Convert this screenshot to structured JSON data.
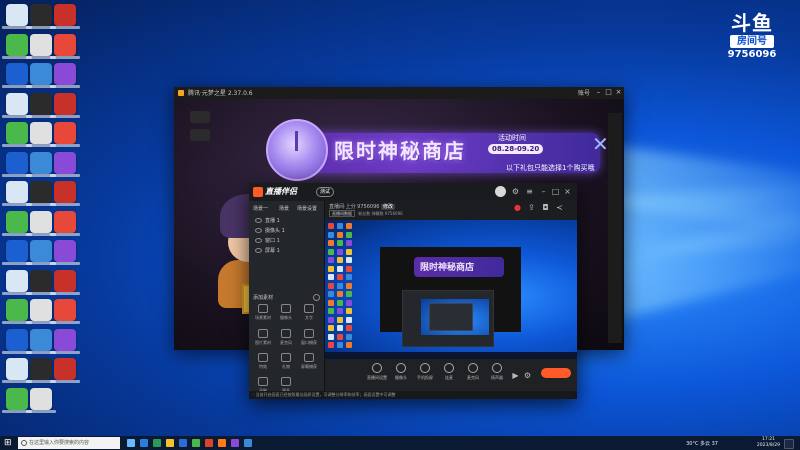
{
  "watermark": {
    "logo": "斗鱼",
    "room_label": "房间号",
    "room_id": "9756096"
  },
  "game_window": {
    "title": "腾讯·元梦之星 2.37.0.6",
    "account": "账号",
    "banner": {
      "title": "限时神秘商店",
      "time_label": "活动时间",
      "time_range": "08.28-09.20",
      "subtitle": "以下礼包只能选择1个购买哦"
    }
  },
  "live_window": {
    "app_name": "直播伴侣",
    "badge": "测试",
    "scene_tabs": [
      "场景一",
      "场景",
      "场景设置"
    ],
    "sources": [
      "直播 1",
      "摄像头 1",
      "窗口 1",
      "屏幕 1"
    ],
    "add_source": "添加素材",
    "tools": [
      {
        "icon": "video-icon",
        "label": "场景素材"
      },
      {
        "icon": "camera-icon",
        "label": "摄像头"
      },
      {
        "icon": "text-icon",
        "label": "文字"
      },
      {
        "icon": "image-icon",
        "label": "图片素材"
      },
      {
        "icon": "mic-icon",
        "label": "麦克风"
      },
      {
        "icon": "window-icon",
        "label": "窗口捕获"
      },
      {
        "icon": "effect-icon",
        "label": "特效"
      },
      {
        "icon": "gift-icon",
        "label": "礼物"
      },
      {
        "icon": "screen-icon",
        "label": "屏幕捕获"
      },
      {
        "icon": "rec-icon",
        "label": "录制"
      },
      {
        "icon": "more-icon",
        "label": "更多"
      }
    ],
    "info_line": "直播间·上分 9756096",
    "info_tag": "修改",
    "stats": [
      "直播间数据",
      "粉丝数",
      "弹幕数",
      "9756096"
    ],
    "preview_title": "限时神秘商店",
    "bottom_buttons": [
      "直播间设置",
      "摄像头",
      "手机投屏",
      "连麦",
      "麦克风",
      "扬声器"
    ],
    "footer": "· 当前开启画面已经按照最佳画质设置，可调整分辨率和帧率；画面设置中可调整"
  },
  "taskbar": {
    "search_placeholder": "在这里输入你要搜索的内容",
    "weather": "30°C 多云",
    "time": "17:21",
    "date": "2023/8/29",
    "notification_count": "37"
  },
  "colors": {
    "accent": "#ff5a28",
    "desktop": "#0c56d8",
    "banner": "#6e3cc8"
  }
}
